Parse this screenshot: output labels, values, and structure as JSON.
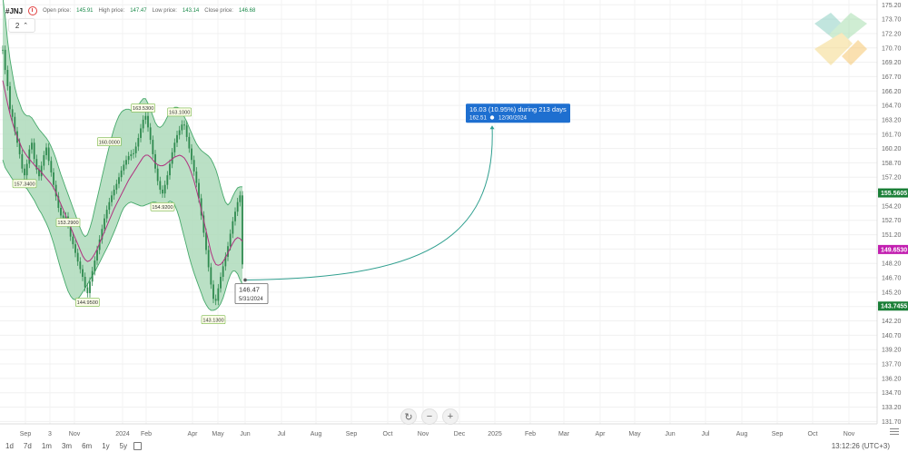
{
  "header": {
    "symbol": "#JNJ",
    "open_label": "Open price:",
    "open_value": "145.91",
    "high_label": "High price:",
    "high_value": "147.47",
    "low_label": "Low price:",
    "low_value": "143.14",
    "close_label": "Close price:",
    "close_value": "146.68",
    "indicator_count": "2"
  },
  "timeframes": [
    "1d",
    "7d",
    "1m",
    "3m",
    "6m",
    "1y",
    "5y"
  ],
  "clock": "13:12:26 (UTC+3)",
  "colors": {
    "band_fill": "#a9d8b6",
    "band_line": "#45a86a",
    "candle": "#2f8a4f",
    "ma": "#b0307f",
    "projection": "#2f9f8f",
    "blue_box": "#1e6fd0",
    "price_green": "#1a7f37",
    "price_magenta": "#c21fb0",
    "label_bg": "#fbfde8",
    "label_border": "#7ab84a"
  },
  "chart_data": {
    "type": "line",
    "y_axis": {
      "ticks": [
        "175.20",
        "173.70",
        "172.20",
        "170.70",
        "169.20",
        "167.70",
        "166.20",
        "164.70",
        "163.20",
        "161.70",
        "160.20",
        "158.70",
        "157.20",
        "155.70",
        "154.20",
        "152.70",
        "151.20",
        "149.70",
        "148.20",
        "146.70",
        "145.20",
        "143.70",
        "142.20",
        "140.70",
        "139.20",
        "137.70",
        "136.20",
        "134.70",
        "133.20",
        "131.70"
      ],
      "range": [
        131.45,
        175.7
      ]
    },
    "x_axis": {
      "ticks": [
        "Sep",
        "3",
        "Nov",
        "2024",
        "Feb",
        "Apr",
        "May",
        "Jun",
        "Jul",
        "Aug",
        "Sep",
        "Oct",
        "Nov",
        "Dec",
        "2025",
        "Feb",
        "Mar",
        "Apr",
        "May",
        "Jun",
        "Jul",
        "Aug",
        "Sep",
        "Oct",
        "Nov"
      ]
    },
    "series": [
      {
        "type": "close",
        "values": [
          170.5,
          168.4,
          166.7,
          164.3,
          163.5,
          162.0,
          160.8,
          159.6,
          158.1,
          157.4,
          158.6,
          160.1,
          160.8,
          159.1,
          158.0,
          157.3,
          158.4,
          159.5,
          160.3,
          158.9,
          157.7,
          156.4,
          155.2,
          154.0,
          153.2,
          152.7,
          153.1,
          152.3,
          151.0,
          150.2,
          149.3,
          148.4,
          147.6,
          146.8,
          145.7,
          145.1,
          146.3,
          147.4,
          148.5,
          149.6,
          150.7,
          151.8,
          152.9,
          153.8,
          154.6,
          155.3,
          155.9,
          156.5,
          157.2,
          157.9,
          158.5,
          159.0,
          159.4,
          159.6,
          159.7,
          160.4,
          161.3,
          162.3,
          163.2,
          163.6,
          162.4,
          161.1,
          159.6,
          158.1,
          156.8,
          155.9,
          155.5,
          156.4,
          157.4,
          158.6,
          159.8,
          160.8,
          161.6,
          162.1,
          162.7,
          162.6,
          161.4,
          160.2,
          159.0,
          157.8,
          156.6,
          155.0,
          153.2,
          151.4,
          149.6,
          147.8,
          146.0,
          144.5,
          144.3,
          145.6,
          146.8,
          147.9,
          148.9,
          150.0,
          151.3,
          152.6,
          153.6,
          154.6,
          155.3,
          148.1
        ]
      },
      {
        "type": "moving_average",
        "values": [
          167.3,
          166.1,
          164.9,
          163.8,
          162.9,
          162.1,
          161.4,
          160.8,
          160.2,
          159.8,
          159.4,
          159.1,
          158.8,
          158.5,
          158.2,
          158.0,
          157.7,
          157.4,
          157.1,
          156.8,
          156.5,
          156.1,
          155.6,
          155.0,
          154.4,
          153.8,
          153.2,
          152.6,
          152.0,
          151.4,
          150.8,
          150.2,
          149.6,
          149.0,
          148.6,
          148.4,
          148.5,
          148.8,
          149.2,
          149.7,
          150.3,
          150.9,
          151.5,
          152.1,
          152.7,
          153.3,
          153.9,
          154.4,
          154.9,
          155.4,
          155.9,
          156.4,
          156.9,
          157.3,
          157.7,
          158.1,
          158.5,
          158.9,
          159.3,
          159.5,
          159.5,
          159.3,
          159.0,
          158.7,
          158.5,
          158.4,
          158.4,
          158.5,
          158.7,
          158.9,
          159.1,
          159.3,
          159.4,
          159.5,
          159.4,
          159.2,
          158.8,
          158.3,
          157.6,
          156.8,
          155.9,
          154.9,
          153.8,
          152.7,
          151.6,
          150.5,
          149.4,
          148.6,
          148.1,
          148.0,
          148.1,
          148.4,
          148.8,
          149.3,
          149.8,
          150.3,
          150.7,
          150.9,
          150.8,
          150.5
        ]
      },
      {
        "type": "upper_band",
        "values": [
          176.0,
          174.0,
          171.5,
          169.5,
          168.0,
          166.6,
          165.6,
          164.9,
          164.2,
          163.8,
          163.6,
          163.6,
          163.4,
          163.0,
          162.6,
          162.2,
          161.9,
          161.6,
          161.3,
          160.9,
          160.4,
          159.8,
          159.1,
          158.3,
          157.5,
          156.8,
          156.1,
          155.4,
          154.7,
          154.0,
          153.3,
          152.6,
          151.9,
          151.3,
          151.0,
          151.2,
          151.9,
          152.8,
          153.9,
          155.0,
          156.1,
          157.2,
          158.3,
          159.4,
          160.4,
          161.4,
          162.3,
          163.0,
          163.6,
          164.0,
          164.2,
          164.3,
          164.3,
          164.2,
          164.1,
          164.3,
          164.7,
          165.1,
          165.4,
          165.4,
          164.9,
          164.3,
          163.6,
          162.9,
          162.5,
          162.4,
          162.6,
          163.0,
          163.5,
          164.0,
          164.3,
          164.5,
          164.5,
          164.4,
          164.0,
          163.5,
          163.0,
          162.4,
          161.8,
          161.2,
          160.7,
          160.3,
          160.0,
          159.8,
          159.6,
          159.4,
          159.1,
          158.6,
          158.0,
          157.2,
          156.2,
          155.3,
          154.6,
          154.3,
          154.6,
          155.2,
          155.7,
          156.1,
          156.2,
          156.2
        ]
      },
      {
        "type": "lower_band",
        "values": [
          159.0,
          158.2,
          157.8,
          157.4,
          157.0,
          156.8,
          156.5,
          156.3,
          156.2,
          156.2,
          156.0,
          155.6,
          155.2,
          154.8,
          154.3,
          153.8,
          153.4,
          152.9,
          152.4,
          151.8,
          151.1,
          150.3,
          149.4,
          148.5,
          147.6,
          146.8,
          146.0,
          145.3,
          144.8,
          144.5,
          144.4,
          144.5,
          144.8,
          145.2,
          145.6,
          146.0,
          146.5,
          146.9,
          147.3,
          147.8,
          148.3,
          148.8,
          149.3,
          149.8,
          150.3,
          150.9,
          151.5,
          152.1,
          152.8,
          153.5,
          154.0,
          154.3,
          154.5,
          154.6,
          154.5,
          154.4,
          154.3,
          154.2,
          154.2,
          154.3,
          154.4,
          154.5,
          154.6,
          154.6,
          154.5,
          154.3,
          154.2,
          154.3,
          154.5,
          154.7,
          154.6,
          154.3,
          153.7,
          152.9,
          151.9,
          150.9,
          149.9,
          148.9,
          148.0,
          147.2,
          146.5,
          145.8,
          145.1,
          144.4,
          143.9,
          143.5,
          143.3,
          143.3,
          143.4,
          143.6,
          144.0,
          144.6,
          145.4,
          146.3,
          147.0,
          147.4,
          147.4,
          147.1,
          146.5,
          146.0
        ]
      }
    ],
    "swing_labels": [
      {
        "text": "157.3400",
        "i": 9,
        "v": 157.34,
        "side": "below"
      },
      {
        "text": "153.2900",
        "i": 27,
        "v": 153.29,
        "side": "below"
      },
      {
        "text": "144.9500",
        "i": 35,
        "v": 144.95,
        "side": "below"
      },
      {
        "text": "160.0000",
        "i": 44,
        "v": 160.0,
        "side": "above"
      },
      {
        "text": "163.5300",
        "i": 58,
        "v": 163.53,
        "side": "above"
      },
      {
        "text": "154.9200",
        "i": 66,
        "v": 154.92,
        "side": "below"
      },
      {
        "text": "163.1000",
        "i": 73,
        "v": 163.1,
        "side": "above"
      },
      {
        "text": "143.1300",
        "i": 87,
        "v": 143.13,
        "side": "below"
      }
    ],
    "current_point": {
      "price": "146.47",
      "date": "5/31/2024",
      "v": 146.47
    },
    "forecast": {
      "line1": "16.03 (10.95%) during 213 days",
      "price": "162.51",
      "date": "12/30/2024",
      "v": 162.51
    },
    "price_tags": [
      {
        "text": "155.5605",
        "v": 155.56,
        "color": "#1a7f37"
      },
      {
        "text": "149.6530",
        "v": 149.653,
        "color": "#c21fb0"
      },
      {
        "text": "143.7455",
        "v": 143.7455,
        "color": "#1a7f37"
      }
    ]
  }
}
